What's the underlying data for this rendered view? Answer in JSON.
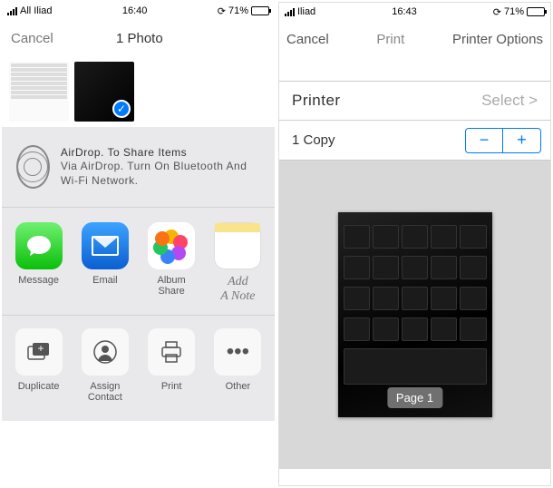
{
  "left": {
    "status": {
      "carrier": "All Iliad",
      "time": "16:40",
      "battery_pct": "71%"
    },
    "nav": {
      "cancel": "Cancel",
      "title": "1 Photo"
    },
    "airdrop": {
      "title": "AirDrop. To Share Items",
      "subtitle": "Via AirDrop. Turn On Bluetooth And Wi-Fi Network."
    },
    "apps": {
      "messages": "Message",
      "email": "Email",
      "album_share_l1": "Album",
      "album_share_l2": "Share",
      "add_l1": "Add",
      "add_l2": "A Note"
    },
    "actions": {
      "duplicate": "Duplicate",
      "assign_l1": "Assign",
      "assign_l2": "Contact",
      "print": "Print",
      "other": "Other"
    }
  },
  "right": {
    "status": {
      "carrier": "Iliad",
      "time": "16:43",
      "battery_pct": "71%"
    },
    "nav": {
      "cancel": "Cancel",
      "print": "Print",
      "options": "Printer Options"
    },
    "printer_label": "Printer",
    "printer_select": "Select >",
    "copies_label": "1 Copy",
    "page_badge": "Page 1"
  }
}
